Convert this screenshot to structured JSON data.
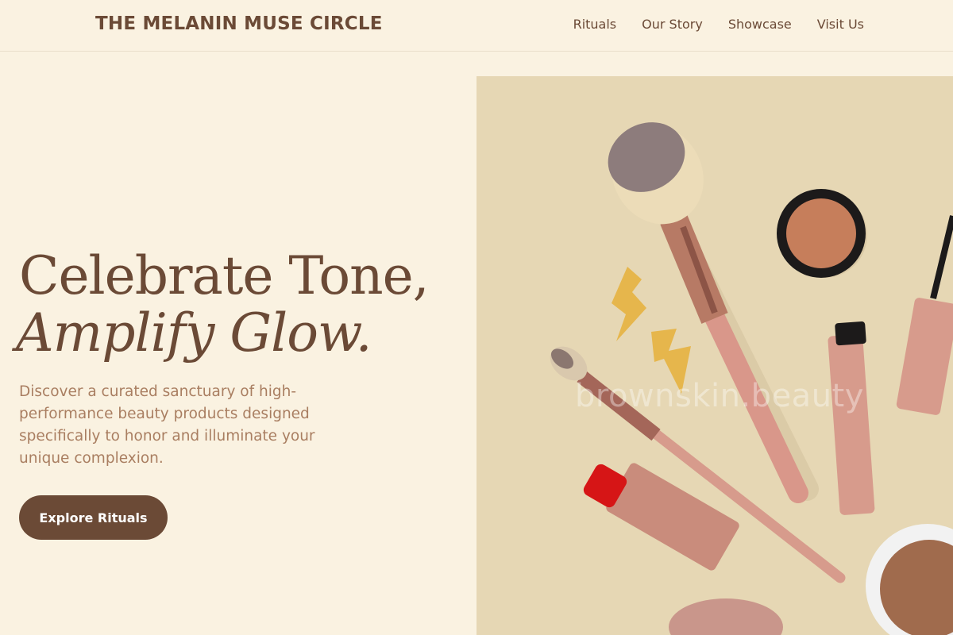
{
  "header": {
    "brand": "THE MELANIN MUSE CIRCLE",
    "nav": [
      "Rituals",
      "Our Story",
      "Showcase",
      "Visit Us"
    ]
  },
  "hero": {
    "title_line1": "Celebrate Tone,",
    "title_line2": "Amplify Glow.",
    "description": "Discover a curated sanctuary of high-performance beauty products designed specifically to honor and illuminate your unique complexion.",
    "cta_label": "Explore Rituals"
  },
  "image": {
    "watermark": "brownskin.beauty",
    "icons": [
      "makeup-brush",
      "compact-powder",
      "mascara",
      "lipstick",
      "lightning-earring",
      "scrunchie"
    ]
  },
  "colors": {
    "background": "#faf2e1",
    "brand_brown": "#6b4a36",
    "body_text": "#a97e61",
    "image_bg": "#e6d7b4",
    "accent_rose": "#d9978a"
  }
}
